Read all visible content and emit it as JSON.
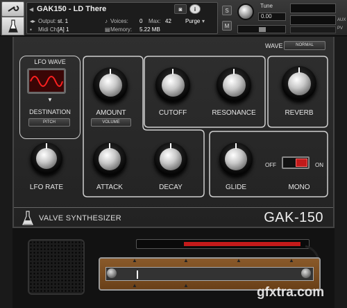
{
  "header": {
    "instrument_name": "GAK150 - LD There",
    "output_label": "Output:",
    "output_value": "st. 1",
    "midi_label": "Midi Ch:",
    "midi_value": "[A] 1",
    "voices_label": "Voices:",
    "voices_value": "0",
    "max_label": "Max:",
    "max_value": "42",
    "memory_label": "Memory:",
    "memory_value": "5.22 MB",
    "purge_label": "Purge",
    "s_label": "S",
    "m_label": "M",
    "tune_label": "Tune",
    "tune_value": "0.00",
    "aux_label": "AUX",
    "pv_label": "PV"
  },
  "synth": {
    "wave_label": "WAVE",
    "wave_value": "NORMAL",
    "lfo_wave_label": "LFO WAVE",
    "destination_label": "DESTINATION",
    "destination_value": "PITCH",
    "lfo_rate_label": "LFO RATE",
    "amount_label": "AMOUNT",
    "amount_value": "VOLUME",
    "cutoff_label": "CUTOFF",
    "resonance_label": "RESONANCE",
    "reverb_label": "REVERB",
    "attack_label": "ATTACK",
    "decay_label": "DECAY",
    "glide_label": "GLIDE",
    "off_label": "OFF",
    "on_label": "ON",
    "mono_label": "MONO",
    "brand_name": "VALVE SYNTHESIZER",
    "model_name": "GAK-150"
  },
  "watermark": "gfxtra.com"
}
